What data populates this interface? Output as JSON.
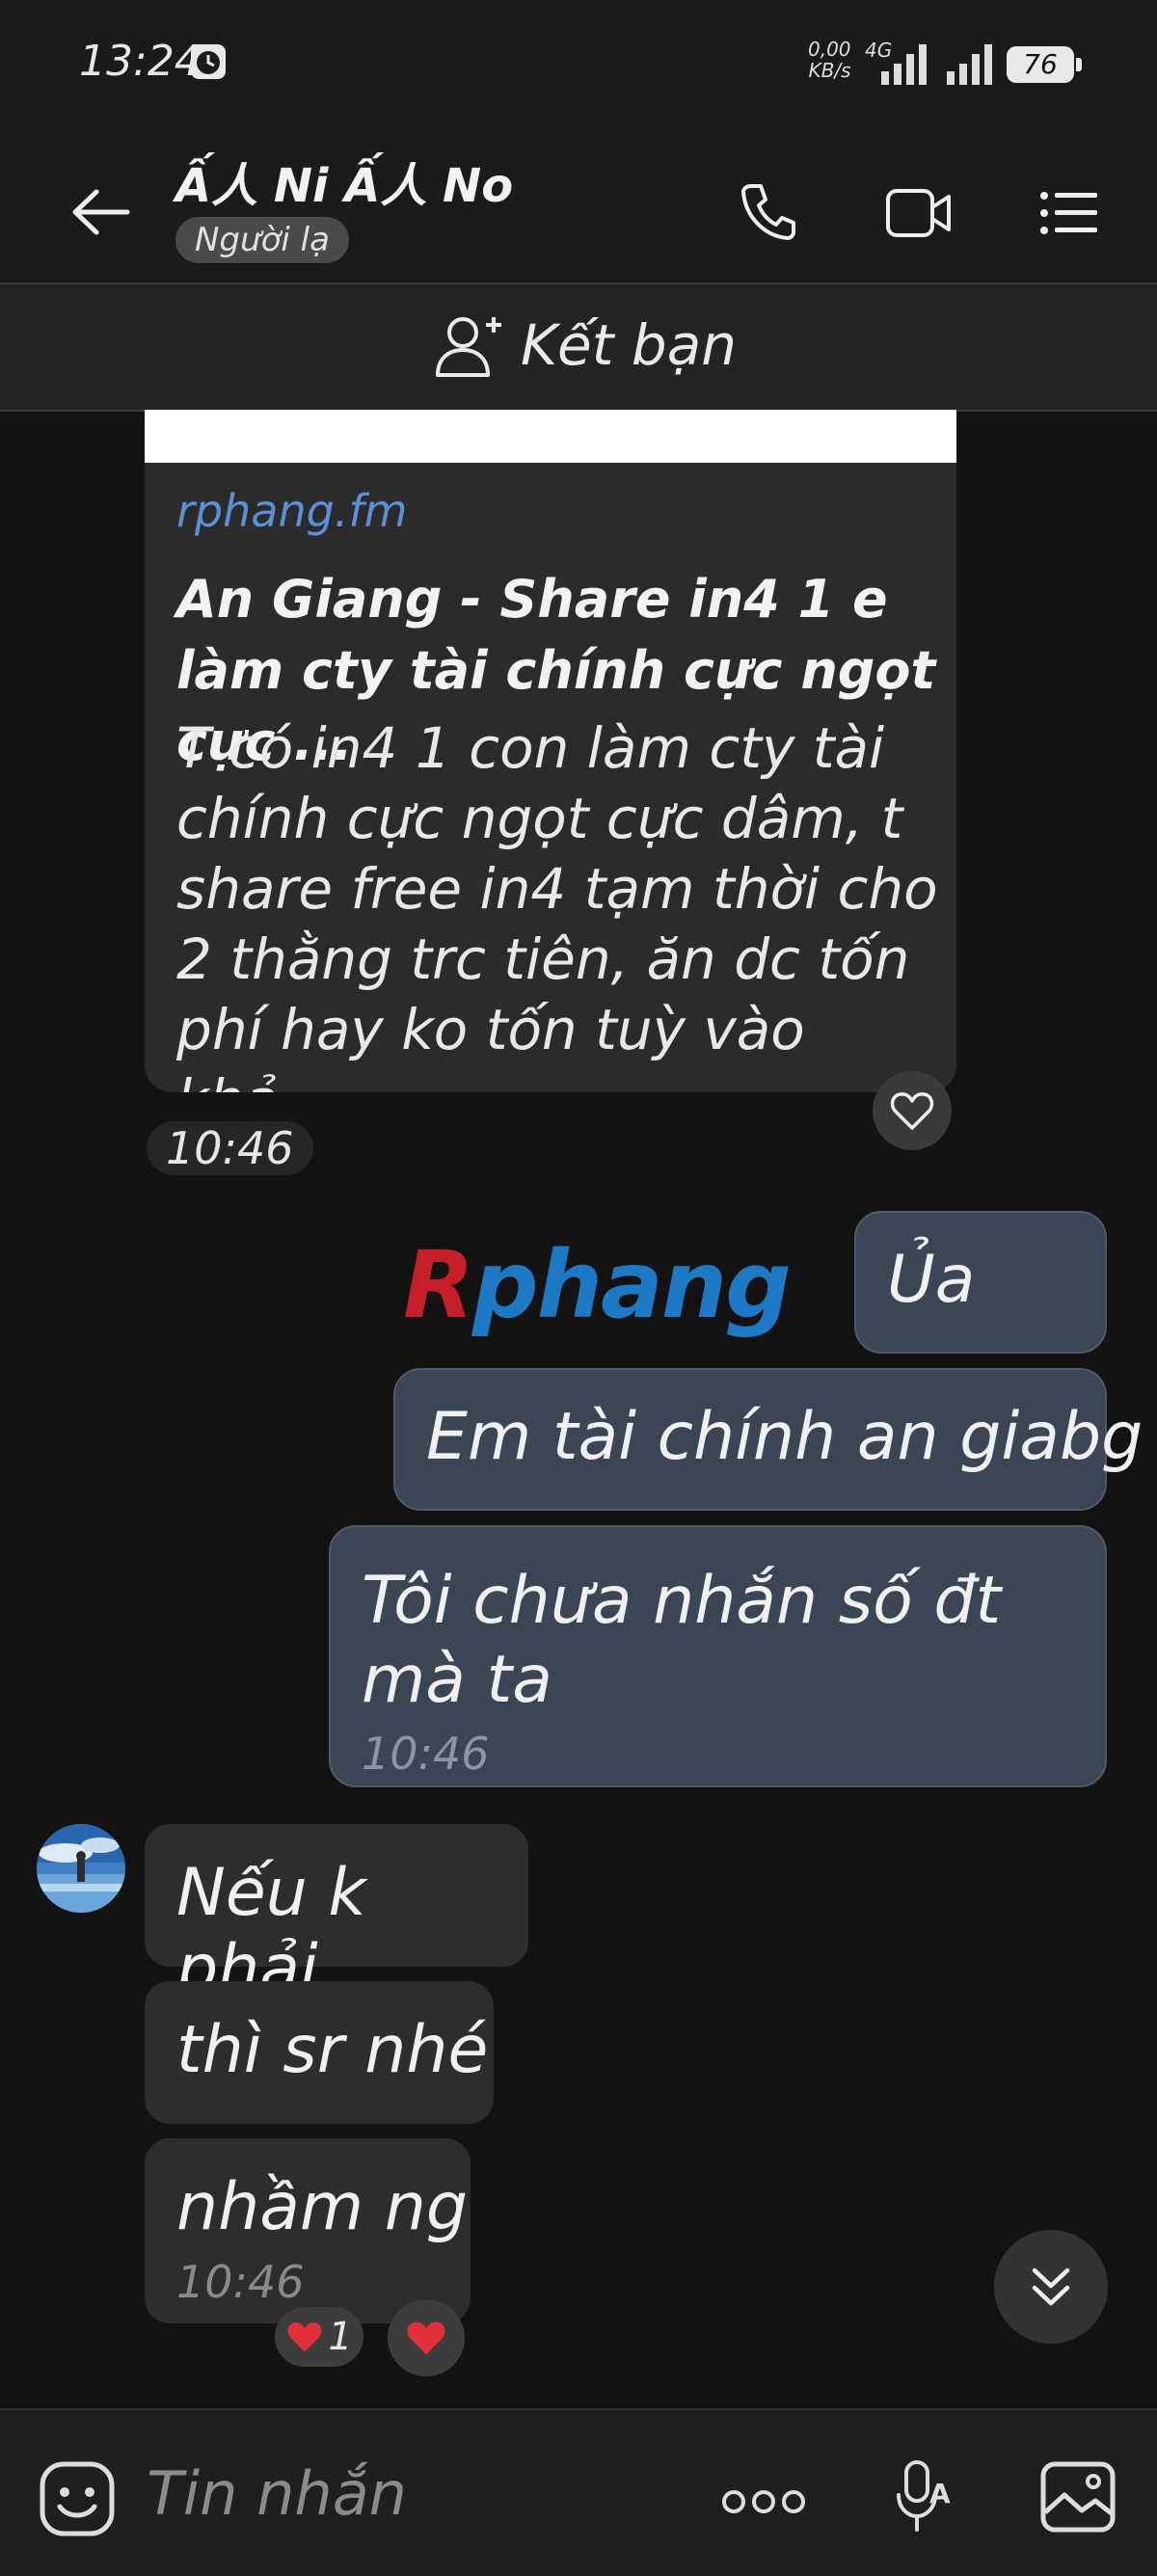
{
  "status_bar": {
    "time": "13:24",
    "net_speed_value": "0,00",
    "net_speed_unit": "KB/s",
    "network_type": "4G",
    "battery": "76"
  },
  "header": {
    "contact_name": "Ấ人 Ni Ấ人 No",
    "badge": "Người lạ"
  },
  "add_friend": {
    "label": "Kết bạn"
  },
  "link_card": {
    "domain": "rphang.fm",
    "title": "An Giang - Share in4 1 e làm cty tài chính cực ngọt cực ...",
    "description": "T có in4 1 con làm cty tài chính cực ngọt cực dâm, t share free in4 tạm thời cho 2 thằng trc tiên, ăn dc tốn phí hay ko tốn tuỳ vào khả...",
    "time": "10:46"
  },
  "watermark": {
    "first": "R",
    "rest": "phang"
  },
  "sent_messages": [
    {
      "text": "Ủa"
    },
    {
      "text": "Em tài chính an giabg"
    },
    {
      "text": "Tôi chưa nhắn số đt mà ta",
      "time": "10:46"
    }
  ],
  "received_messages": [
    {
      "text": "Nếu k phải"
    },
    {
      "text": "thì sr nhé"
    },
    {
      "text": "nhầm ng",
      "time": "10:46"
    }
  ],
  "reactions": {
    "count": "1"
  },
  "composer": {
    "placeholder": "Tin nhắn"
  },
  "colors": {
    "sent_bubble": "#3c4554",
    "received_bubble": "#2d2d2d",
    "link": "#5b8fd6",
    "heart": "#e0303a"
  }
}
